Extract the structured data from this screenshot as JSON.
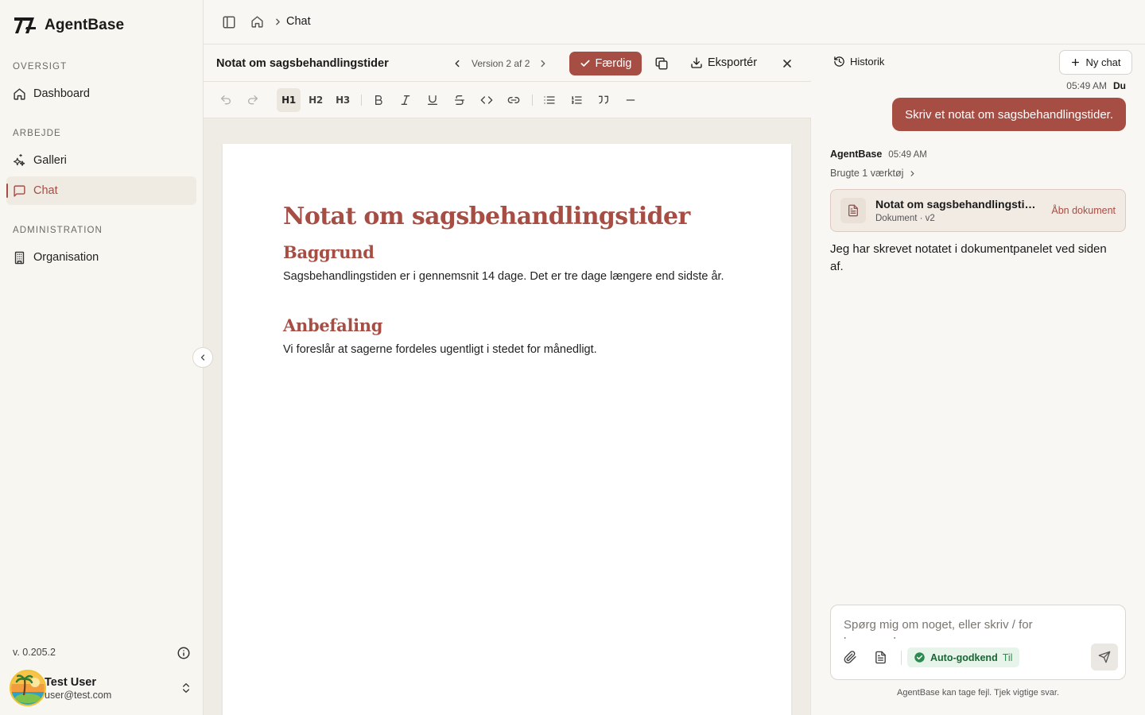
{
  "app": {
    "name": "AgentBase"
  },
  "sidebar": {
    "sections": [
      {
        "label": "OVERSIGT",
        "items": [
          {
            "label": "Dashboard",
            "icon": "home-icon"
          }
        ]
      },
      {
        "label": "ARBEJDE",
        "items": [
          {
            "label": "Galleri",
            "icon": "sparkles-icon"
          },
          {
            "label": "Chat",
            "icon": "message-square-icon",
            "active": true
          }
        ]
      },
      {
        "label": "ADMINISTRATION",
        "items": [
          {
            "label": "Organisation",
            "icon": "building-icon"
          }
        ]
      }
    ],
    "version": "v. 0.205.2",
    "user": {
      "name": "Test User",
      "email": "user@test.com"
    }
  },
  "breadcrumb": {
    "current": "Chat"
  },
  "document": {
    "title": "Notat om sagsbehandlingstider",
    "version_label": "Version 2 af 2",
    "done_label": "Færdig",
    "export_label": "Eksportér",
    "toolbar": {
      "h1": "H1",
      "h2": "H2",
      "h3": "H3"
    },
    "content": {
      "heading": "Notat om sagsbehandlingstider",
      "section1_title": "Baggrund",
      "section1_text": "Sagsbehandlingstiden er i gennemsnit 14 dage. Det er tre dage længere end sidste år.",
      "section2_title": "Anbefaling",
      "section2_text": "Vi foreslår at sagerne fordeles ugentligt i stedet for månedligt."
    }
  },
  "chat": {
    "history_label": "Historik",
    "new_chat_label": "Ny chat",
    "messages": {
      "user": {
        "time": "05:49 AM",
        "author": "Du",
        "text": "Skriv et notat om sagsbehandlingstider."
      },
      "agent": {
        "author": "AgentBase",
        "time": "05:49 AM",
        "tools_used": "Brugte 1 værktøj",
        "card": {
          "title": "Notat om sagsbehandlingstider",
          "subtitle": "Dokument · v2",
          "action": "Åbn dokument"
        },
        "text": "Jeg har skrevet notatet i dokumentpanelet ved siden af."
      }
    },
    "composer": {
      "placeholder": "Spørg mig om noget, eller skriv / for kommandoer",
      "auto_approve_label": "Auto-godkend",
      "auto_approve_state": "Til"
    },
    "disclaimer": "AgentBase kan tage fejl. Tjek vigtige svar."
  },
  "colors": {
    "accent": "#a64d44",
    "sidebar_bg": "#f8f6f1",
    "success": "#2e8b4f"
  }
}
